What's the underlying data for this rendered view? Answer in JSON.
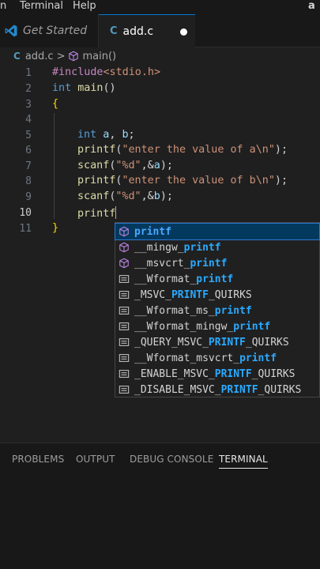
{
  "menubar": {
    "items": [
      "n",
      "Terminal",
      "Help"
    ],
    "right_glyph": "a"
  },
  "tabs": [
    {
      "label": "Get Started",
      "icon": "vscode-icon"
    },
    {
      "label": "add.c",
      "icon": "c-file-icon",
      "icon_text": "C",
      "dirty": true
    }
  ],
  "breadcrumb": {
    "file_icon_text": "C",
    "file": "add.c",
    "separator": ">",
    "symbol": "main()"
  },
  "editor": {
    "line_numbers": [
      "1",
      "2",
      "3",
      "4",
      "5",
      "6",
      "7",
      "8",
      "9",
      "10",
      "11"
    ],
    "active_line": 10
  },
  "suggest": {
    "items": [
      {
        "pre": "",
        "match": "printf",
        "post": "",
        "icon": "method-icon"
      },
      {
        "pre": "__mingw_",
        "match": "printf",
        "post": "",
        "icon": "method-icon"
      },
      {
        "pre": "__msvcrt_",
        "match": "printf",
        "post": "",
        "icon": "method-icon"
      },
      {
        "pre": "__Wformat_",
        "match": "printf",
        "post": "",
        "icon": "constant-icon"
      },
      {
        "pre": "_MSVC_",
        "match": "PRINTF",
        "post": "_QUIRKS",
        "icon": "constant-icon"
      },
      {
        "pre": "__Wformat_ms_",
        "match": "printf",
        "post": "",
        "icon": "constant-icon"
      },
      {
        "pre": "__Wformat_mingw_",
        "match": "printf",
        "post": "",
        "icon": "constant-icon"
      },
      {
        "pre": "_QUERY_MSVC_",
        "match": "PRINTF",
        "post": "_QUIRKS",
        "icon": "constant-icon"
      },
      {
        "pre": "__Wformat_msvcrt_",
        "match": "printf",
        "post": "",
        "icon": "constant-icon"
      },
      {
        "pre": "_ENABLE_MSVC_",
        "match": "PRINTF",
        "post": "_QUIRKS",
        "icon": "constant-icon"
      },
      {
        "pre": "_DISABLE_MSVC_",
        "match": "PRINTF",
        "post": "_QUIRKS",
        "icon": "constant-icon"
      }
    ]
  },
  "panel": {
    "tabs": [
      "PROBLEMS",
      "OUTPUT",
      "DEBUG CONSOLE",
      "TERMINAL"
    ],
    "active": "TERMINAL"
  },
  "colors": {
    "keyword": "#569cd6",
    "string": "#ce9178",
    "function": "#dcdcaa",
    "match": "#2aaaff",
    "accent": "#0078d4"
  }
}
